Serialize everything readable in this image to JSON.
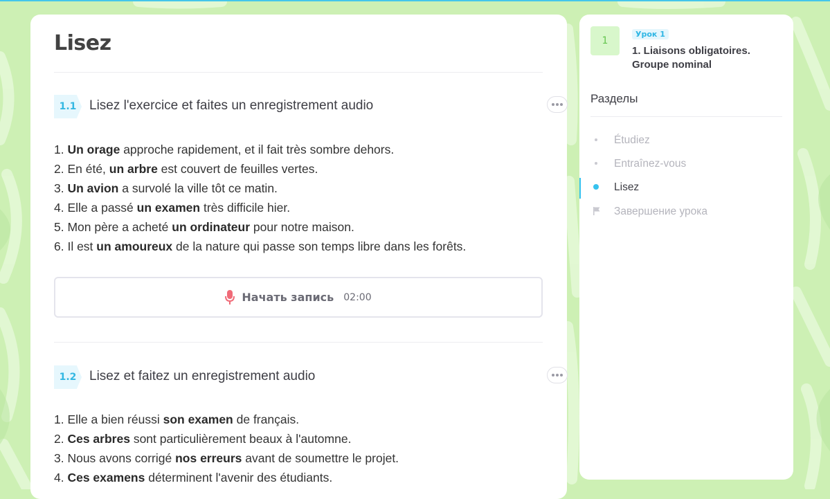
{
  "main": {
    "title": "Lisez",
    "exercises": [
      {
        "number": "1.1",
        "title": "Lisez l'exercice et faites un enregistrement audio",
        "sentences": [
          {
            "pre": "1. ",
            "bold": "Un orage",
            "post": " approche rapidement, et il fait très sombre dehors."
          },
          {
            "pre": "2. En été, ",
            "bold": "un arbre",
            "post": " est couvert de feuilles vertes."
          },
          {
            "pre": "3. ",
            "bold": "Un avion",
            "post": " a survolé la ville tôt ce matin."
          },
          {
            "pre": "4. Elle a passé ",
            "bold": "un examen",
            "post": " très difficile hier."
          },
          {
            "pre": "5. Mon père a acheté ",
            "bold": "un ordinateur",
            "post": " pour notre maison."
          },
          {
            "pre": "6. Il est ",
            "bold": "un amoureux",
            "post": " de la nature qui passe son temps libre dans les forêts."
          }
        ],
        "record": {
          "label": "Начать запись",
          "time": "02:00",
          "icon": "microphone-icon"
        }
      },
      {
        "number": "1.2",
        "title": "Lisez et faitez un enregistrement audio",
        "sentences": [
          {
            "pre": "1. Elle a bien réussi ",
            "bold": "son examen",
            "post": " de français."
          },
          {
            "pre": "2. ",
            "bold": "Ces arbres",
            "post": " sont particulièrement beaux à l'automne."
          },
          {
            "pre": "3. Nous avons corrigé ",
            "bold": "nos erreurs",
            "post": " avant de soumettre le projet."
          },
          {
            "pre": "4. ",
            "bold": "Ces examens",
            "post": " déterminent l'avenir des étudiants."
          }
        ]
      }
    ]
  },
  "sidebar": {
    "lesson_number": "1",
    "lesson_tag": "Урок 1",
    "lesson_title": "1. Liaisons obligatoires. Groupe nominal",
    "sections_title": "Разделы",
    "sections": [
      {
        "label": "Étudiez",
        "state": "inactive",
        "icon": "dot-icon"
      },
      {
        "label": "Entraînez-vous",
        "state": "inactive",
        "icon": "dot-icon"
      },
      {
        "label": "Lisez",
        "state": "active",
        "icon": "dot-icon"
      },
      {
        "label": "Завершение урока",
        "state": "inactive",
        "icon": "flag-icon"
      }
    ]
  },
  "colors": {
    "background": "#cdf0b4",
    "accent": "#36c2ee",
    "mic": "#f06b78",
    "lesson_badge": "#62c44c"
  }
}
